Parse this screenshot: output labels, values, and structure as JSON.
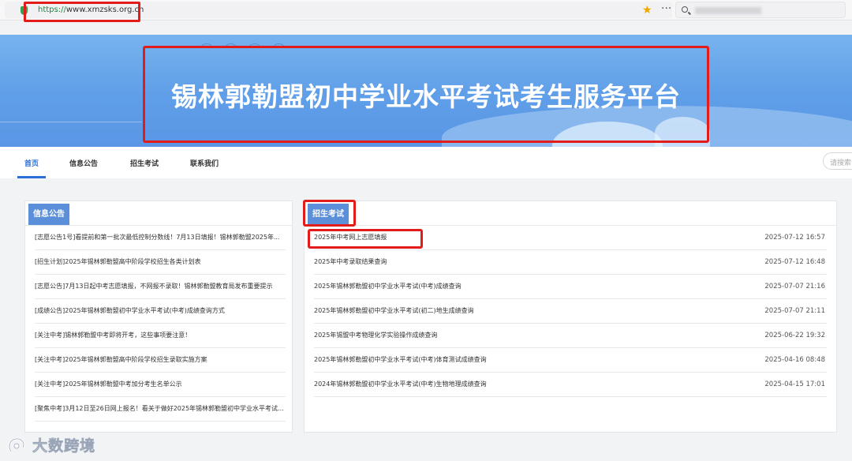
{
  "browser": {
    "url_scheme": "https://",
    "url_host": "www.xmzsks.org.cn",
    "star_icon": "star-icon",
    "more_icon": "more-icon",
    "search_icon": "search-icon"
  },
  "banner": {
    "title": "锡林郭勒盟初中学业水平考试考生服务平台"
  },
  "nav": {
    "items": [
      "首页",
      "信息公告",
      "招生考试",
      "联系我们"
    ],
    "active": "首页",
    "search_placeholder": "请搜索"
  },
  "notices": {
    "title": "信息公告",
    "items": [
      "[志愿公告1号]看提前和第一批次最低控制分数线！7月13日填报！锡林郭勒盟2025年...",
      "[招生计划]2025年锡林郭勒盟高中阶段学校招生各类计划表",
      "[志愿公告]7月13日起中考志愿填报，不网报不录取！锡林郭勒盟教育局发布重要提示",
      "[成绩公告]2025年锡林郭勒盟初中学业水平考试(中考)成绩查询方式",
      "[关注中考]锡林郭勒盟中考即将开考，这些事项要注意！",
      "[关注中考]2025年锡林郭勒盟高中阶段学校招生录取实施方案",
      "[关注中考]2025年锡林郭勒盟中考加分考生名单公示",
      "[聚焦中考]3月12日至26日网上报名！看关于做好2025年锡林郭勒盟初中学业水平考试..."
    ]
  },
  "exams": {
    "title": "招生考试",
    "items": [
      {
        "title": "2025年中考网上志愿填报",
        "date": "2025-07-12 16:57"
      },
      {
        "title": "2025年中考录取结果查询",
        "date": "2025-07-12 16:48"
      },
      {
        "title": "2025年锡林郭勒盟初中学业水平考试(中考)成绩查询",
        "date": "2025-07-07 21:16"
      },
      {
        "title": "2025年锡林郭勒盟初中学业水平考试(初二)地生成绩查询",
        "date": "2025-07-07 21:11"
      },
      {
        "title": "2025年锡盟中考物理化学实验操作成绩查询",
        "date": "2025-06-22 19:32"
      },
      {
        "title": "2025年锡林郭勒盟初中学业水平考试(中考)体育测试成绩查询",
        "date": "2025-04-16 08:48"
      },
      {
        "title": "2024年锡林郭勒盟初中学业水平考试(中考)生物地理成绩查询",
        "date": "2025-04-15 17:01"
      }
    ]
  },
  "watermark": {
    "text": "大数跨境"
  },
  "colors": {
    "accent": "#2b6fd6",
    "tab_bg": "#5b8fd9",
    "highlight": "#e21b1b",
    "banner": "#6aa8ec"
  }
}
